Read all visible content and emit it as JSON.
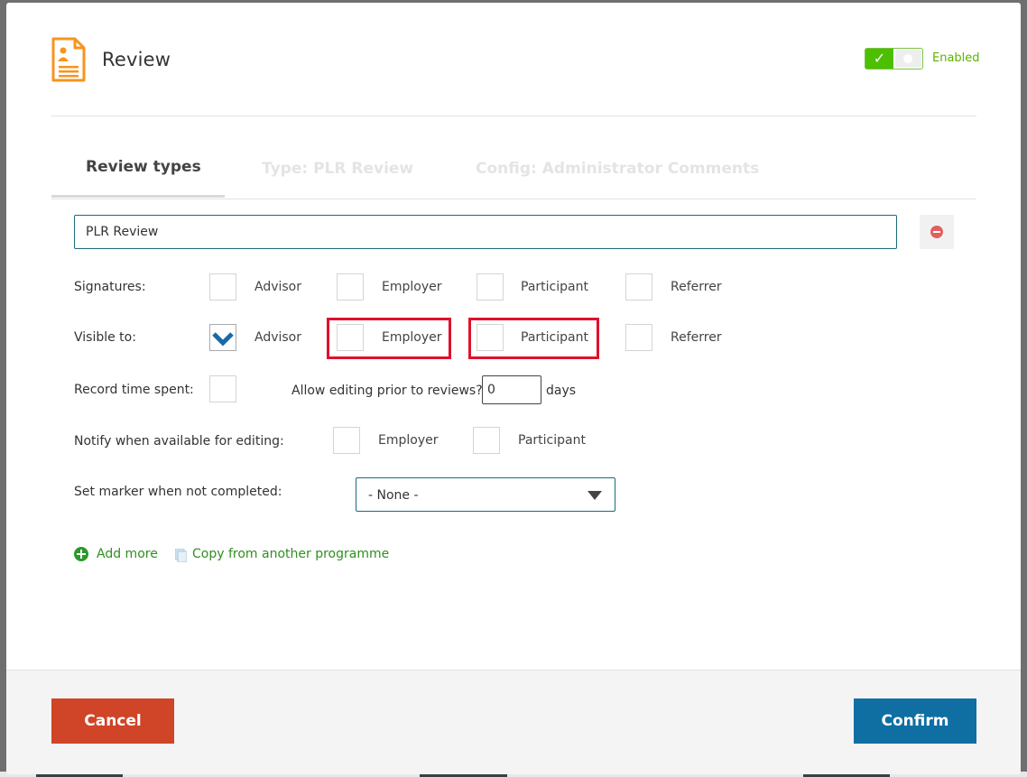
{
  "header": {
    "title": "Review",
    "toggle": {
      "enabled": true,
      "label": "Enabled"
    }
  },
  "tabs": [
    {
      "label": "Review types",
      "active": true
    },
    {
      "label": "Type: PLR Review",
      "active": false
    },
    {
      "label": "Config: Administrator Comments",
      "active": false
    }
  ],
  "review_type": {
    "name_value": "PLR Review",
    "signatures": {
      "label": "Signatures:",
      "options": [
        {
          "label": "Advisor",
          "checked": false
        },
        {
          "label": "Employer",
          "checked": false
        },
        {
          "label": "Participant",
          "checked": false
        },
        {
          "label": "Referrer",
          "checked": false
        }
      ]
    },
    "visible_to": {
      "label": "Visible to:",
      "options": [
        {
          "label": "Advisor",
          "checked": true
        },
        {
          "label": "Employer",
          "checked": false
        },
        {
          "label": "Participant",
          "checked": false
        },
        {
          "label": "Referrer",
          "checked": false
        }
      ]
    },
    "record_time": {
      "label": "Record time spent:",
      "checked": false
    },
    "allow_editing": {
      "label": "Allow editing prior to reviews?",
      "value": "0",
      "unit": "days"
    },
    "notify": {
      "label": "Notify when available for editing:",
      "options": [
        {
          "label": "Employer",
          "checked": false
        },
        {
          "label": "Participant",
          "checked": false
        }
      ]
    },
    "marker": {
      "label": "Set marker when not completed:",
      "selected": "- None -"
    }
  },
  "links": {
    "add_more": "Add more",
    "copy": "Copy from another programme"
  },
  "footer": {
    "cancel": "Cancel",
    "confirm": "Confirm"
  },
  "colors": {
    "accent": "#0f6fa3",
    "cancel": "#d04427",
    "enabled_green": "#4cc000",
    "highlight_red": "#e0112b",
    "icon_orange": "#f7941d"
  }
}
